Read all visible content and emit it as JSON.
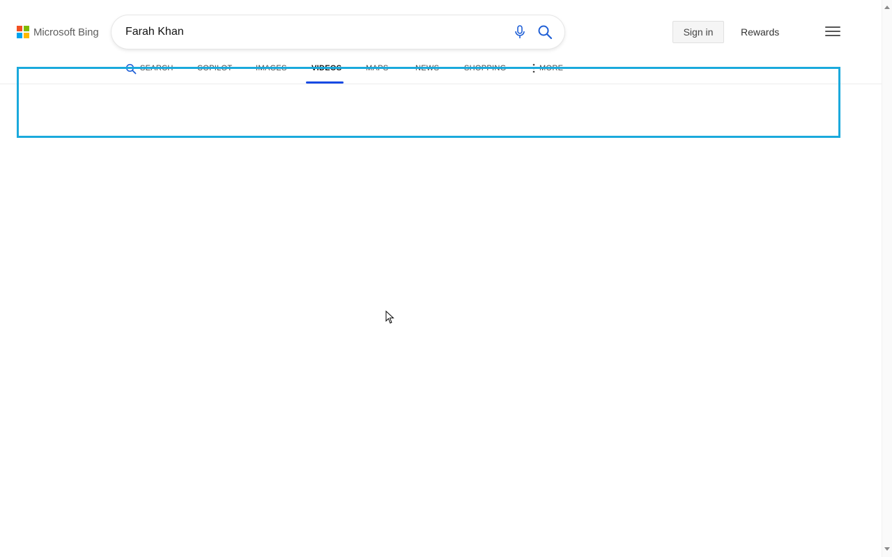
{
  "header": {
    "logo_text": "Microsoft Bing",
    "logo_colors": [
      "#f25022",
      "#7fba00",
      "#00a4ef",
      "#ffb900"
    ],
    "search": {
      "value": "Farah Khan",
      "mic_icon": "microphone-icon",
      "search_icon": "search-icon"
    },
    "sign_in_label": "Sign in",
    "rewards_label": "Rewards",
    "menu_icon": "hamburger-menu-icon"
  },
  "tabs": [
    {
      "label": "SEARCH",
      "icon": "search-icon",
      "active": false
    },
    {
      "label": "COPILOT",
      "active": false
    },
    {
      "label": "IMAGES",
      "active": false
    },
    {
      "label": "VIDEOS",
      "active": true
    },
    {
      "label": "MAPS",
      "active": false
    },
    {
      "label": "NEWS",
      "active": false
    },
    {
      "label": "SHOPPING",
      "active": false
    },
    {
      "label": "MORE",
      "icon": "vertical-ellipsis-icon",
      "active": false
    }
  ],
  "colors": {
    "accent": "#174ae4",
    "highlight_box": "#1aa9dc"
  }
}
